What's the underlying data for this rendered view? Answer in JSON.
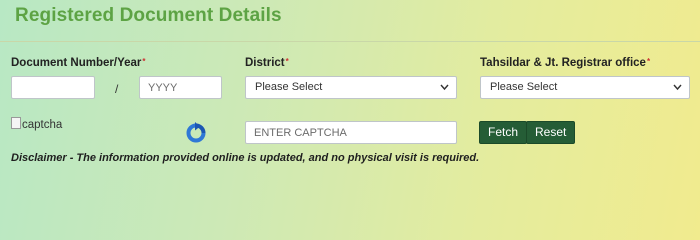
{
  "page": {
    "title": "Registered Document Details"
  },
  "form": {
    "doc_label": "Document Number/Year",
    "required_mark": "*",
    "doc_number": {
      "value": "",
      "placeholder": ""
    },
    "separator": "/",
    "year": {
      "value": "",
      "placeholder": "YYYY"
    },
    "district_label": "District",
    "district_select": {
      "selected": "Please Select"
    },
    "office_label": "Tahsildar & Jt. Registrar office",
    "office_select": {
      "selected": "Please Select"
    },
    "captcha_alt": "captcha",
    "captcha_input": {
      "value": "",
      "placeholder": "ENTER CAPTCHA"
    },
    "fetch_label": "Fetch",
    "reset_label": "Reset"
  },
  "disclaimer": "Disclaimer - The information provided online is updated, and no physical visit is required.",
  "icons": {
    "refresh": "refresh-icon",
    "dropdown": "chevron-down-icon",
    "broken_image": "broken-image-icon"
  },
  "colors": {
    "title": "#5da344",
    "button": "#255d36",
    "required": "#cc3333"
  }
}
